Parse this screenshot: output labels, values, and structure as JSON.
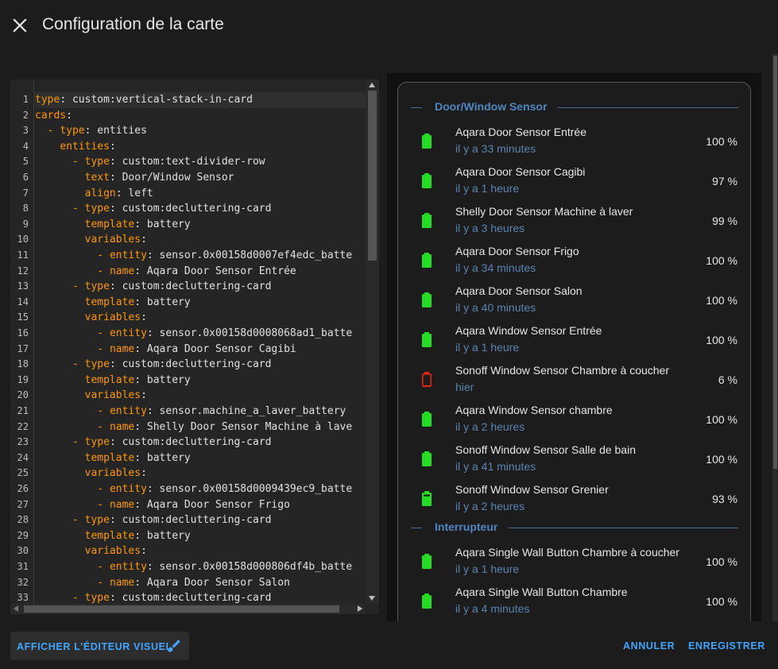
{
  "dialog": {
    "title": "Configuration de la carte"
  },
  "editor": {
    "lines": [
      {
        "n": "1",
        "parts": [
          [
            "k",
            "type"
          ],
          [
            "v",
            ": custom:vertical-stack-in-card"
          ]
        ]
      },
      {
        "n": "2",
        "parts": [
          [
            "k",
            "cards"
          ],
          [
            "v",
            ":"
          ]
        ]
      },
      {
        "n": "3",
        "parts": [
          [
            "v",
            "  "
          ],
          [
            "d",
            "-"
          ],
          [
            "v",
            " "
          ],
          [
            "k",
            "type"
          ],
          [
            "v",
            ": entities"
          ]
        ]
      },
      {
        "n": "4",
        "parts": [
          [
            "v",
            "    "
          ],
          [
            "k",
            "entities"
          ],
          [
            "v",
            ":"
          ]
        ]
      },
      {
        "n": "5",
        "parts": [
          [
            "v",
            "      "
          ],
          [
            "d",
            "-"
          ],
          [
            "v",
            " "
          ],
          [
            "k",
            "type"
          ],
          [
            "v",
            ": custom:text-divider-row"
          ]
        ]
      },
      {
        "n": "6",
        "parts": [
          [
            "v",
            "        "
          ],
          [
            "k",
            "text"
          ],
          [
            "v",
            ": Door/Window Sensor"
          ]
        ]
      },
      {
        "n": "7",
        "parts": [
          [
            "v",
            "        "
          ],
          [
            "k",
            "align"
          ],
          [
            "v",
            ": left"
          ]
        ]
      },
      {
        "n": "8",
        "parts": [
          [
            "v",
            "      "
          ],
          [
            "d",
            "-"
          ],
          [
            "v",
            " "
          ],
          [
            "k",
            "type"
          ],
          [
            "v",
            ": custom:decluttering-card"
          ]
        ]
      },
      {
        "n": "9",
        "parts": [
          [
            "v",
            "        "
          ],
          [
            "k",
            "template"
          ],
          [
            "v",
            ": battery"
          ]
        ]
      },
      {
        "n": "10",
        "parts": [
          [
            "v",
            "        "
          ],
          [
            "k",
            "variables"
          ],
          [
            "v",
            ":"
          ]
        ]
      },
      {
        "n": "11",
        "parts": [
          [
            "v",
            "          "
          ],
          [
            "d",
            "-"
          ],
          [
            "v",
            " "
          ],
          [
            "k",
            "entity"
          ],
          [
            "v",
            ": sensor.0x00158d0007ef4edc_batte"
          ]
        ]
      },
      {
        "n": "12",
        "parts": [
          [
            "v",
            "          "
          ],
          [
            "d",
            "-"
          ],
          [
            "v",
            " "
          ],
          [
            "k",
            "name"
          ],
          [
            "v",
            ": Aqara Door Sensor Entrée"
          ]
        ]
      },
      {
        "n": "13",
        "parts": [
          [
            "v",
            "      "
          ],
          [
            "d",
            "-"
          ],
          [
            "v",
            " "
          ],
          [
            "k",
            "type"
          ],
          [
            "v",
            ": custom:decluttering-card"
          ]
        ]
      },
      {
        "n": "14",
        "parts": [
          [
            "v",
            "        "
          ],
          [
            "k",
            "template"
          ],
          [
            "v",
            ": battery"
          ]
        ]
      },
      {
        "n": "15",
        "parts": [
          [
            "v",
            "        "
          ],
          [
            "k",
            "variables"
          ],
          [
            "v",
            ":"
          ]
        ]
      },
      {
        "n": "16",
        "parts": [
          [
            "v",
            "          "
          ],
          [
            "d",
            "-"
          ],
          [
            "v",
            " "
          ],
          [
            "k",
            "entity"
          ],
          [
            "v",
            ": sensor.0x00158d0008068ad1_batte"
          ]
        ]
      },
      {
        "n": "17",
        "parts": [
          [
            "v",
            "          "
          ],
          [
            "d",
            "-"
          ],
          [
            "v",
            " "
          ],
          [
            "k",
            "name"
          ],
          [
            "v",
            ": Aqara Door Sensor Cagibi"
          ]
        ]
      },
      {
        "n": "18",
        "parts": [
          [
            "v",
            "      "
          ],
          [
            "d",
            "-"
          ],
          [
            "v",
            " "
          ],
          [
            "k",
            "type"
          ],
          [
            "v",
            ": custom:decluttering-card"
          ]
        ]
      },
      {
        "n": "19",
        "parts": [
          [
            "v",
            "        "
          ],
          [
            "k",
            "template"
          ],
          [
            "v",
            ": battery"
          ]
        ]
      },
      {
        "n": "20",
        "parts": [
          [
            "v",
            "        "
          ],
          [
            "k",
            "variables"
          ],
          [
            "v",
            ":"
          ]
        ]
      },
      {
        "n": "21",
        "parts": [
          [
            "v",
            "          "
          ],
          [
            "d",
            "-"
          ],
          [
            "v",
            " "
          ],
          [
            "k",
            "entity"
          ],
          [
            "v",
            ": sensor.machine_a_laver_battery"
          ]
        ]
      },
      {
        "n": "22",
        "parts": [
          [
            "v",
            "          "
          ],
          [
            "d",
            "-"
          ],
          [
            "v",
            " "
          ],
          [
            "k",
            "name"
          ],
          [
            "v",
            ": Shelly Door Sensor Machine à lave"
          ]
        ]
      },
      {
        "n": "23",
        "parts": [
          [
            "v",
            "      "
          ],
          [
            "d",
            "-"
          ],
          [
            "v",
            " "
          ],
          [
            "k",
            "type"
          ],
          [
            "v",
            ": custom:decluttering-card"
          ]
        ]
      },
      {
        "n": "24",
        "parts": [
          [
            "v",
            "        "
          ],
          [
            "k",
            "template"
          ],
          [
            "v",
            ": battery"
          ]
        ]
      },
      {
        "n": "25",
        "parts": [
          [
            "v",
            "        "
          ],
          [
            "k",
            "variables"
          ],
          [
            "v",
            ":"
          ]
        ]
      },
      {
        "n": "26",
        "parts": [
          [
            "v",
            "          "
          ],
          [
            "d",
            "-"
          ],
          [
            "v",
            " "
          ],
          [
            "k",
            "entity"
          ],
          [
            "v",
            ": sensor.0x00158d0009439ec9_batte"
          ]
        ]
      },
      {
        "n": "27",
        "parts": [
          [
            "v",
            "          "
          ],
          [
            "d",
            "-"
          ],
          [
            "v",
            " "
          ],
          [
            "k",
            "name"
          ],
          [
            "v",
            ": Aqara Door Sensor Frigo"
          ]
        ]
      },
      {
        "n": "28",
        "parts": [
          [
            "v",
            "      "
          ],
          [
            "d",
            "-"
          ],
          [
            "v",
            " "
          ],
          [
            "k",
            "type"
          ],
          [
            "v",
            ": custom:decluttering-card"
          ]
        ]
      },
      {
        "n": "29",
        "parts": [
          [
            "v",
            "        "
          ],
          [
            "k",
            "template"
          ],
          [
            "v",
            ": battery"
          ]
        ]
      },
      {
        "n": "30",
        "parts": [
          [
            "v",
            "        "
          ],
          [
            "k",
            "variables"
          ],
          [
            "v",
            ":"
          ]
        ]
      },
      {
        "n": "31",
        "parts": [
          [
            "v",
            "          "
          ],
          [
            "d",
            "-"
          ],
          [
            "v",
            " "
          ],
          [
            "k",
            "entity"
          ],
          [
            "v",
            ": sensor.0x00158d000806df4b_batte"
          ]
        ]
      },
      {
        "n": "32",
        "parts": [
          [
            "v",
            "          "
          ],
          [
            "d",
            "-"
          ],
          [
            "v",
            " "
          ],
          [
            "k",
            "name"
          ],
          [
            "v",
            ": Aqara Door Sensor Salon"
          ]
        ]
      },
      {
        "n": "33",
        "parts": [
          [
            "v",
            "      "
          ],
          [
            "d",
            "-"
          ],
          [
            "v",
            " "
          ],
          [
            "k",
            "type"
          ],
          [
            "v",
            ": custom:decluttering-card"
          ]
        ]
      }
    ]
  },
  "preview": {
    "sections": [
      {
        "title": "Door/Window Sensor",
        "rows": [
          {
            "name": "Aqara Door Sensor Entrée",
            "time": "il y a 33 minutes",
            "value": "100 %",
            "level": 100,
            "status": "full"
          },
          {
            "name": "Aqara Door Sensor Cagibi",
            "time": "il y a 1 heure",
            "value": "97 %",
            "level": 97,
            "status": "full"
          },
          {
            "name": "Shelly Door Sensor Machine à laver",
            "time": "il y a 3 heures",
            "value": "99 %",
            "level": 99,
            "status": "full"
          },
          {
            "name": "Aqara Door Sensor Frigo",
            "time": "il y a 34 minutes",
            "value": "100 %",
            "level": 100,
            "status": "full"
          },
          {
            "name": "Aqara Door Sensor Salon",
            "time": "il y a 40 minutes",
            "value": "100 %",
            "level": 100,
            "status": "full"
          },
          {
            "name": "Aqara Window Sensor Entrée",
            "time": "il y a 1 heure",
            "value": "100 %",
            "level": 100,
            "status": "full"
          },
          {
            "name": "Sonoff Window Sensor Chambre à coucher",
            "time": "hier",
            "value": "6 %",
            "level": 6,
            "status": "low"
          },
          {
            "name": "Aqara Window Sensor chambre",
            "time": "il y a 2 heures",
            "value": "100 %",
            "level": 100,
            "status": "full"
          },
          {
            "name": "Sonoff Window Sensor Salle de bain",
            "time": "il y a 41 minutes",
            "value": "100 %",
            "level": 100,
            "status": "full"
          },
          {
            "name": "Sonoff Window Sensor Grenier",
            "time": "il y a 2 heures",
            "value": "93 %",
            "level": 93,
            "status": "high"
          }
        ]
      },
      {
        "title": "Interrupteur",
        "rows": [
          {
            "name": "Aqara Single Wall Button Chambre à coucher",
            "time": "il y a 1 heure",
            "value": "100 %",
            "level": 100,
            "status": "full"
          },
          {
            "name": "Aqara Single Wall Button Chambre",
            "time": "il y a 4 minutes",
            "value": "100 %",
            "level": 100,
            "status": "full"
          }
        ]
      }
    ]
  },
  "footer": {
    "visual_editor_label": "AFFICHER L'ÉDITEUR VISUEL",
    "cancel_label": "ANNULER",
    "save_label": "ENREGISTRER"
  },
  "colors": {
    "background": "#1c1c1c",
    "accent": "#3ea6ff",
    "battery_ok": "#22dd22",
    "battery_low": "#ee2211",
    "divider_text": "#4f86c0",
    "secondary_text": "#5a84b0",
    "yaml_key": "#ff9800"
  },
  "icons": {
    "close": "close-icon",
    "pencil": "pencil-brush-icon",
    "battery_ok": "battery-icon",
    "battery_low": "battery-alert-icon"
  }
}
